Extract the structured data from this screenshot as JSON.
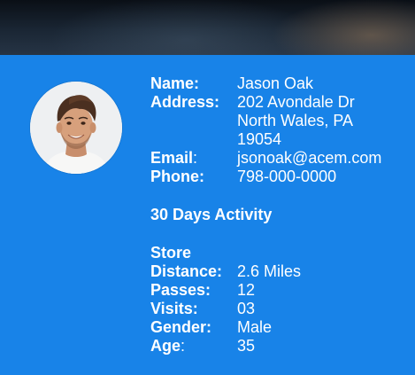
{
  "profile": {
    "name_label": "Name:",
    "name": "Jason Oak",
    "address_label": "Address:",
    "address_lines": [
      "202 Avondale Dr",
      "North Wales, PA",
      "19054"
    ],
    "email_label": "Email",
    "email_colon": ":",
    "email": "jsonoak@acem.com",
    "phone_label": "Phone:",
    "phone": "798-000-0000"
  },
  "activity": {
    "title": "30 Days Activity",
    "store_label": "Store",
    "distance_label": "Distance:",
    "distance": "2.6 Miles",
    "passes_label": "Passes:",
    "passes": "12",
    "visits_label": "Visits:",
    "visits": "03",
    "gender_label": "Gender:",
    "gender": "Male",
    "age_label": "Age",
    "age_colon": ":",
    "age": "35"
  },
  "colors": {
    "card": "#1883e8",
    "text": "#ffffff"
  }
}
